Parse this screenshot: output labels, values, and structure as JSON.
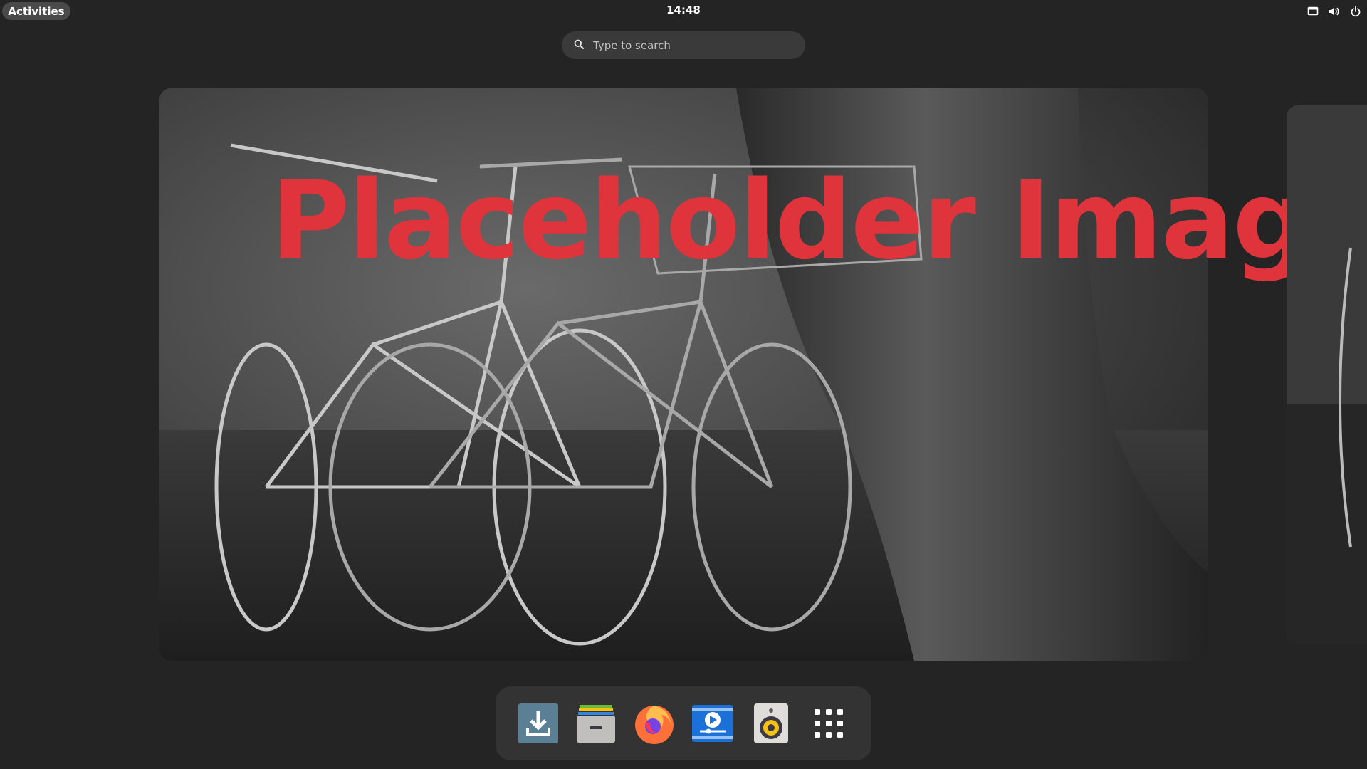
{
  "top_bar": {
    "activities_label": "Activities",
    "clock": "14:48",
    "tray": [
      {
        "icon": "screen-icon"
      },
      {
        "icon": "volume-icon"
      },
      {
        "icon": "power-icon"
      }
    ]
  },
  "search": {
    "placeholder": "Type to search",
    "value": ""
  },
  "workspace": {
    "wallpaper_text": "Placeholder Image"
  },
  "dash": {
    "apps": [
      {
        "icon": "downloads-icon"
      },
      {
        "icon": "file-cabinet-icon"
      },
      {
        "icon": "firefox-icon"
      },
      {
        "icon": "video-player-icon"
      },
      {
        "icon": "speaker-icon"
      },
      {
        "icon": "app-grid-icon"
      }
    ]
  },
  "colors": {
    "background": "#242424",
    "dash": "#333333",
    "search": "#3a3a3a",
    "placeholder_text": "#e0343d"
  }
}
